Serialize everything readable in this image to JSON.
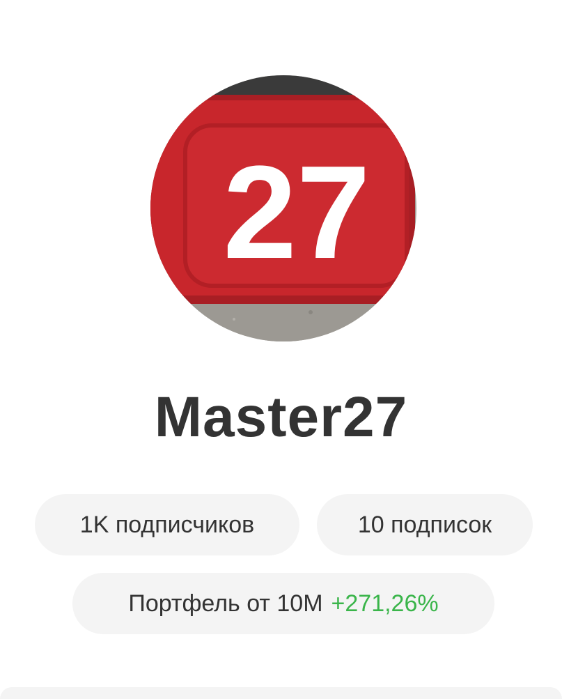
{
  "profile": {
    "avatar": {
      "icon": "house-number-plate-avatar",
      "plate_text": "27",
      "plate_color": "#c8262c"
    },
    "username": "Master27",
    "stats": {
      "followers_label": "1K подписчиков",
      "following_label": "10 подписок"
    },
    "portfolio": {
      "label": "Портфель от 10M",
      "gain": "+271,26%",
      "gain_color": "#3ab54a"
    }
  }
}
